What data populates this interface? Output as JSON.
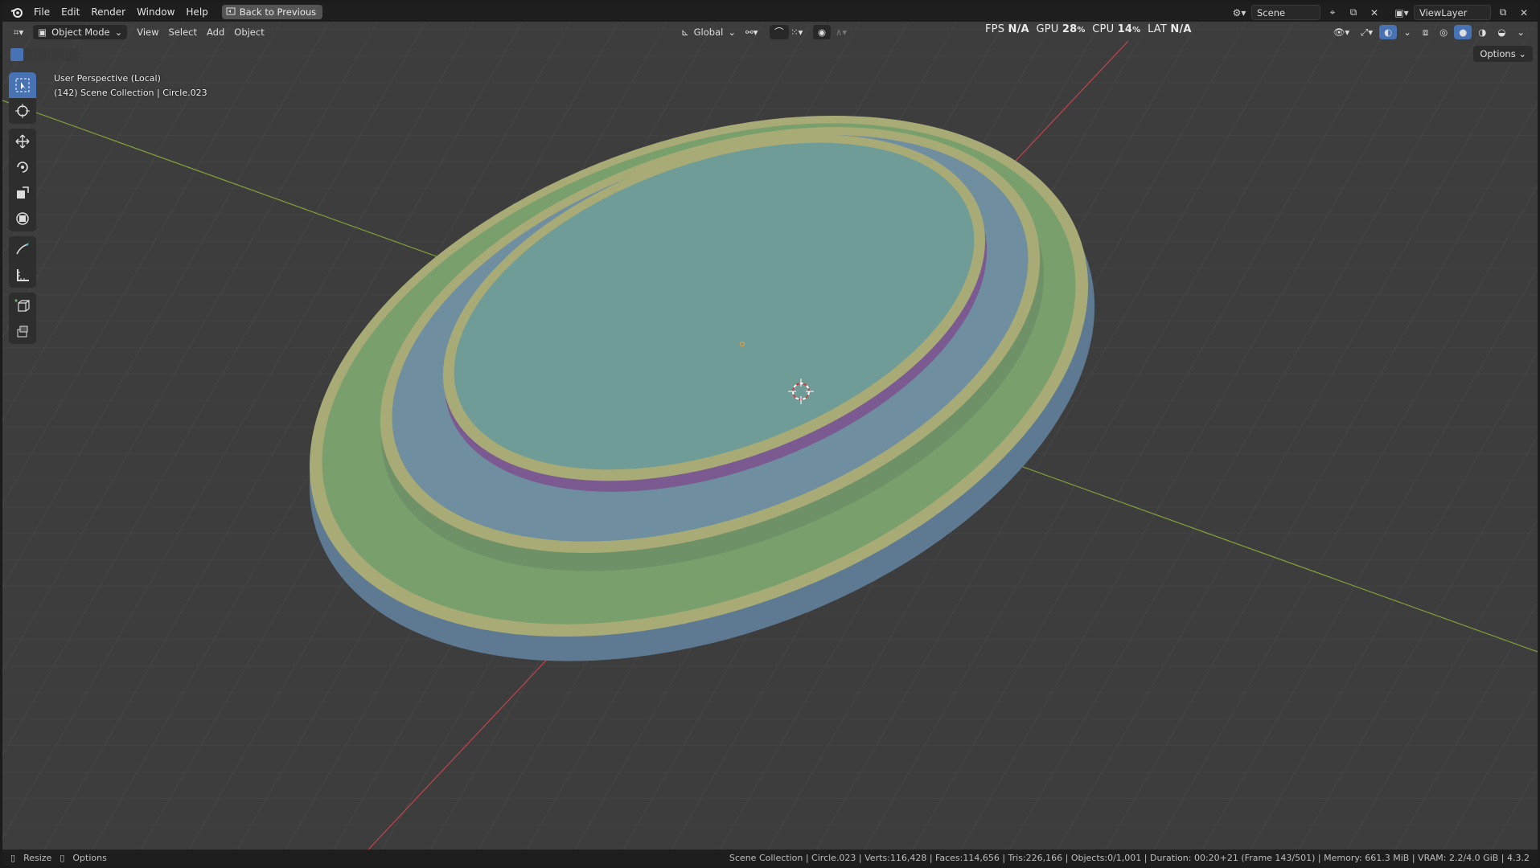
{
  "menubar": {
    "items": [
      "File",
      "Edit",
      "Render",
      "Window",
      "Help"
    ],
    "back_button": "Back to Previous",
    "scene_field": "Scene",
    "viewlayer_field": "ViewLayer"
  },
  "header": {
    "mode": "Object Mode",
    "menus": [
      "View",
      "Select",
      "Add",
      "Object"
    ],
    "transform_orientation": "Global",
    "perf": {
      "fps_label": "FPS",
      "fps_value": "N/A",
      "gpu_label": "GPU",
      "gpu_value": "28",
      "cpu_label": "CPU",
      "cpu_value": "14",
      "lat_label": "LAT",
      "lat_value": "N/A",
      "percent": "%"
    },
    "options_label": "Options"
  },
  "viewport": {
    "perspective": "User Perspective (Local)",
    "collection": "(142) Scene Collection | Circle.023"
  },
  "statusbar": {
    "resize": "Resize",
    "options": "Options",
    "info": "Scene Collection | Circle.023 | Verts:116,428 | Faces:114,656 | Tris:226,166 | Objects:0/1,001 | Duration: 00:20+21 (Frame 143/501) | Memory: 661.3 MiB | VRAM: 2.2/4.0 GiB | 4.3.2"
  },
  "colors": {
    "grid_bg": "#3d3d3d",
    "x_axis": "#c2444e",
    "y_axis": "#7fa13a",
    "ring_outer_green": "#79a06c",
    "ring_yellow": "#a8ab76",
    "ring_blue": "#6f8fa0",
    "center_teal": "#6f9c96",
    "side_blue": "#5d7a92",
    "side_purple": "#7a5a90",
    "active_tool": "#4772b3"
  }
}
